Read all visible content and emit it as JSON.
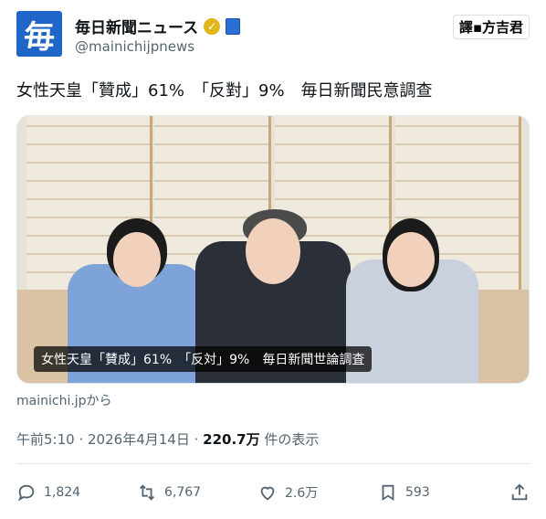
{
  "account": {
    "avatar_text": "毎",
    "display_name": "毎日新聞ニュース",
    "handle": "@mainichijpnews"
  },
  "watermark": "譯▪方吉君",
  "tweet": {
    "text": "女性天皇「贊成」61%　「反對」9%　毎日新聞民意調查"
  },
  "media": {
    "caption": "女性天皇「賛成」61%　「反対」9%　毎日新聞世論調査"
  },
  "card": {
    "source": "mainichi.jpから"
  },
  "meta": {
    "time": "午前5:10",
    "date": "2026年4月14日",
    "views_count": "220.7万",
    "views_label": "件の表示"
  },
  "actions": {
    "replies": "1,824",
    "reposts": "6,767",
    "likes": "2.6万",
    "bookmarks": "593"
  },
  "colors": {
    "brand_blue": "#1f66c8",
    "verified_gold": "#e2b719",
    "text_secondary": "#536471"
  }
}
